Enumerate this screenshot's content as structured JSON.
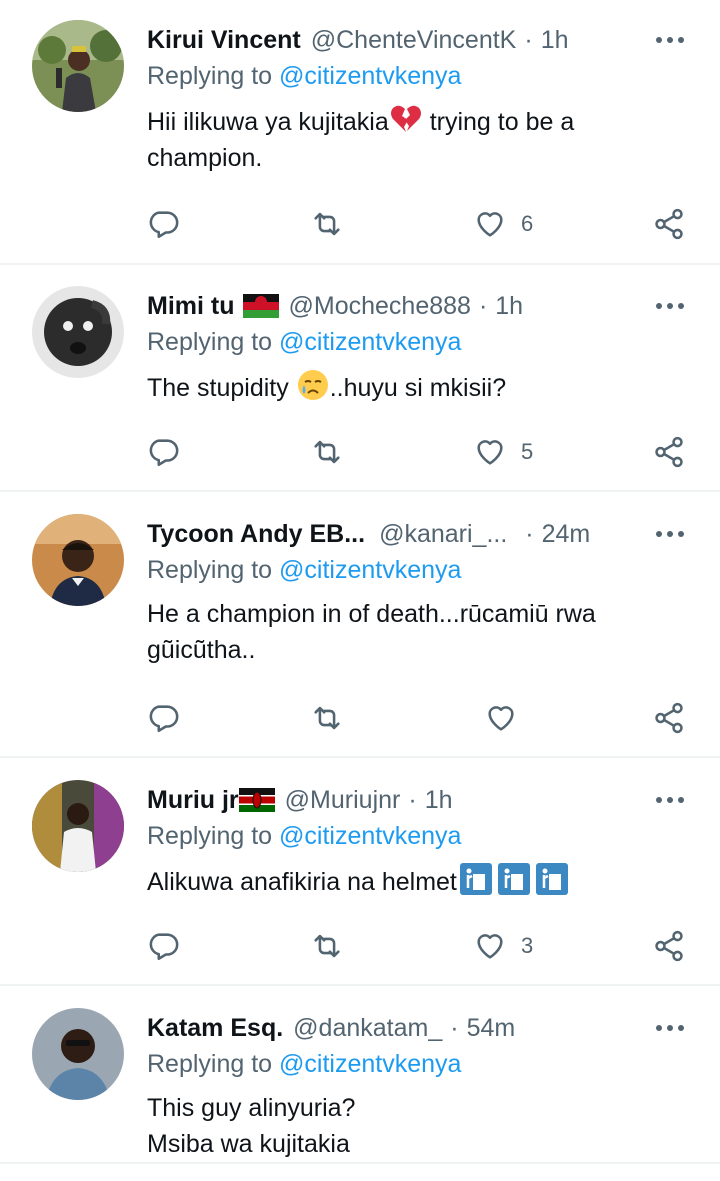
{
  "reply_prefix": "Replying to",
  "tweets": [
    {
      "name": "Kirui Vincent",
      "handle": "@ChenteVincentK",
      "time": "1h",
      "replying_to": "@citizentvkenya",
      "text_lines": [
        "Hii ilikuwa ya kujitakia",
        " trying to be a",
        "champion."
      ],
      "likes": "6",
      "text_emoji": "broken-heart"
    },
    {
      "name": "Mimi tu",
      "flag": "malawi-flag",
      "handle": "@Mocheche888",
      "time": "1h",
      "replying_to": "@citizentvkenya",
      "text_lines": [
        "The stupidity ",
        "..huyu si mkisii?"
      ],
      "likes": "5",
      "text_emoji": "crying-face"
    },
    {
      "name": "Tycoon Andy EB...",
      "handle": "@kanari_...",
      "time": "24m",
      "replying_to": "@citizentvkenya",
      "text_lines": [
        "He a champion in of death...rūcamiū rwa",
        "gũicũtha.."
      ],
      "likes": ""
    },
    {
      "name": "Muriu jr",
      "flag": "kenya-flag",
      "handle": "@Muriujnr",
      "time": "1h",
      "replying_to": "@citizentvkenya",
      "text_lines": [
        "Alikuwa anafikiria na helmet"
      ],
      "likes": "3",
      "text_emoji": "litter-bin-symbol"
    },
    {
      "name": "Katam Esq.",
      "handle": "@dankatam_",
      "time": "54m",
      "replying_to": "@citizentvkenya",
      "text_lines": [
        "This guy alinyuria?",
        "Msiba wa kujitakia"
      ],
      "likes": ""
    }
  ],
  "colors": {
    "text": "#0f1419",
    "secondary": "#536471",
    "accent": "#1d9bf0",
    "divider": "#eff3f4"
  }
}
